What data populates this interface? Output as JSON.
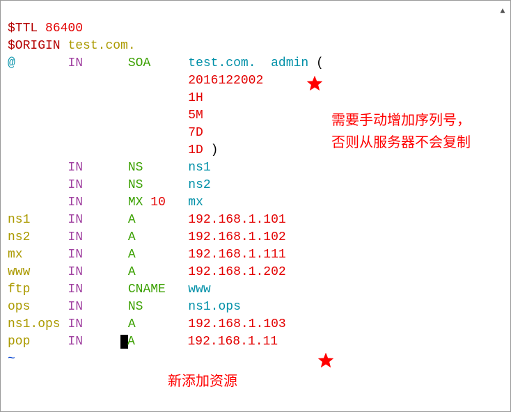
{
  "ttl": {
    "directive": "$TTL",
    "value": "86400"
  },
  "origin": {
    "directive": "$ORIGIN",
    "domain": "test.com."
  },
  "soa": {
    "name": "@",
    "class": "IN",
    "type": "SOA",
    "mname": "test.com.",
    "rname": "admin",
    "open": "(",
    "serial": "2016122002",
    "refresh": "1H",
    "retry": "5M",
    "expire": "7D",
    "minimum": "1D",
    "close": ")"
  },
  "records": [
    {
      "name": "",
      "class": "IN",
      "type": "NS",
      "extra": "",
      "value": "ns1"
    },
    {
      "name": "",
      "class": "IN",
      "type": "NS",
      "extra": "",
      "value": "ns2"
    },
    {
      "name": "",
      "class": "IN",
      "type": "MX",
      "extra": "10",
      "value": "mx"
    },
    {
      "name": "ns1",
      "class": "IN",
      "type": "A",
      "extra": "",
      "value": "192.168.1.101"
    },
    {
      "name": "ns2",
      "class": "IN",
      "type": "A",
      "extra": "",
      "value": "192.168.1.102"
    },
    {
      "name": "mx",
      "class": "IN",
      "type": "A",
      "extra": "",
      "value": "192.168.1.111"
    },
    {
      "name": "www",
      "class": "IN",
      "type": "A",
      "extra": "",
      "value": "192.168.1.202"
    },
    {
      "name": "ftp",
      "class": "IN",
      "type": "CNAME",
      "extra": "",
      "value": "www"
    },
    {
      "name": "ops",
      "class": "IN",
      "type": "NS",
      "extra": "",
      "value": "ns1.ops"
    },
    {
      "name": "ns1.ops",
      "class": "IN",
      "type": "A",
      "extra": "",
      "value": "192.168.1.103"
    },
    {
      "name": "pop",
      "class": "IN",
      "type": "A",
      "extra": "",
      "value": "192.168.1.11"
    }
  ],
  "annotations": {
    "serial_line1": "需要手动增加序列号，",
    "serial_line2": "否则从服务器不会复制",
    "bottom": "新添加资源"
  },
  "tilde": "~"
}
